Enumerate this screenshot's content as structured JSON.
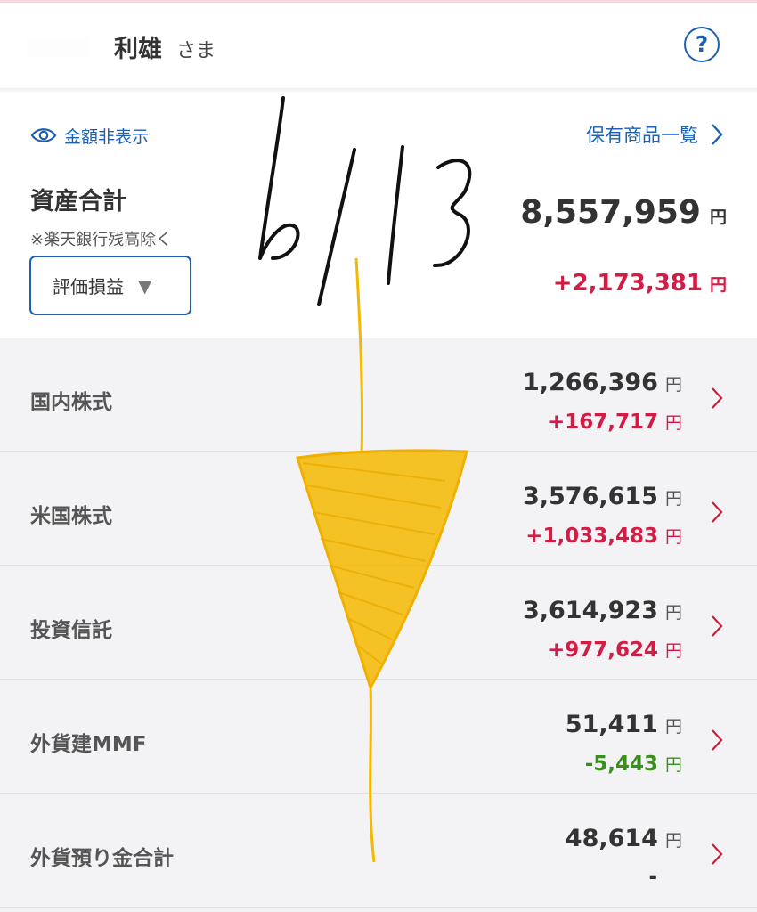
{
  "header": {
    "user_name": "利雄",
    "user_suffix": "さま",
    "help_icon": "question-circle-icon",
    "help_label": "?"
  },
  "summary": {
    "hide_amounts_label": "金額非表示",
    "hide_amounts_icon": "eye-icon",
    "holdings_link_label": "保有商品一覧",
    "title": "資産合計",
    "note": "※楽天銀行残高除く",
    "total_value": "8,557,959",
    "total_gain": "+2,173,381",
    "currency": "円",
    "dropdown_value": "評価損益",
    "dropdown_caret": "▼"
  },
  "assets": [
    {
      "name": "国内株式",
      "value": "1,266,396",
      "gain": "+167,717",
      "gain_status": "pos"
    },
    {
      "name": "米国株式",
      "value": "3,576,615",
      "gain": "+1,033,483",
      "gain_status": "pos"
    },
    {
      "name": "投資信託",
      "value": "3,614,923",
      "gain": "+977,624",
      "gain_status": "pos"
    },
    {
      "name": "外貨建MMF",
      "value": "51,411",
      "gain": "-5,443",
      "gain_status": "neg"
    },
    {
      "name": "外貨預り金合計",
      "value": "48,614",
      "gain": "-",
      "gain_status": "none"
    }
  ],
  "currency_unit": "円",
  "annotation": {
    "handwritten_date": "6/13",
    "pen_color": "#000000",
    "highlight_color": "#f5b800"
  },
  "colors": {
    "accent_blue": "#1f5fb0",
    "gain_red": "#d11c46",
    "loss_green": "#3a8f1e"
  }
}
